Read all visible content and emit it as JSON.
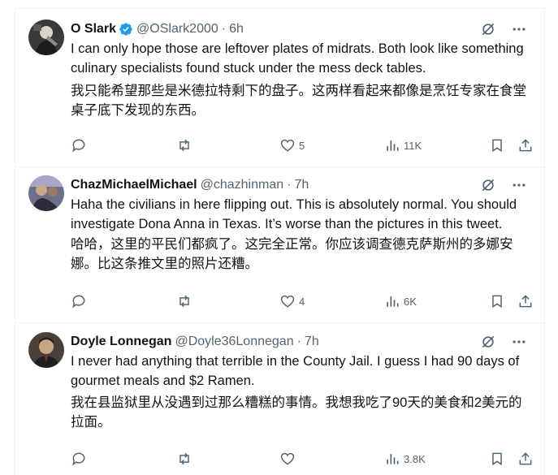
{
  "colors": {
    "text": "#0f1419",
    "muted": "#536471",
    "verified": "#1d9bf0",
    "border": "#eff3f4"
  },
  "tweets": [
    {
      "name": "O Slark",
      "verified": true,
      "handle": "@OSlark2000",
      "dot": "·",
      "time": "6h",
      "text_en": "I can only hope those are leftover plates of midrats. Both look like something culinary specialists found stuck under the mess deck tables.",
      "text_zh": "我只能希望那些是米德拉特剩下的盘子。这两样看起来都像是烹饪专家在食堂桌子底下发现的东西。",
      "replies": "",
      "reposts": "",
      "likes": "5",
      "views": "11K"
    },
    {
      "name": "ChazMichaelMichael",
      "verified": false,
      "handle": "@chazhinman",
      "dot": "·",
      "time": "7h",
      "text_en": "Haha the civilians in here flipping out. This is absolutely normal. You should investigate Dona Anna in Texas. It’s worse than the pictures in this tweet.",
      "text_zh": "哈哈，这里的平民们都疯了。这完全正常。你应该调查德克萨斯州的多娜安娜。比这条推文里的照片还糟。",
      "replies": "",
      "reposts": "",
      "likes": "4",
      "views": "6K"
    },
    {
      "name": "Doyle Lonnegan",
      "verified": false,
      "handle": "@Doyle36Lonnegan",
      "dot": "·",
      "time": "7h",
      "text_en": "I never had anything that terrible in the County Jail. I guess I had 90 days of gourmet meals and $2 Ramen.",
      "text_zh": "我在县监狱里从没遇到过那么糟糕的事情。我想我吃了90天的美食和2美元的拉面。",
      "replies": "",
      "reposts": "",
      "likes": "",
      "views": "3.8K"
    }
  ]
}
